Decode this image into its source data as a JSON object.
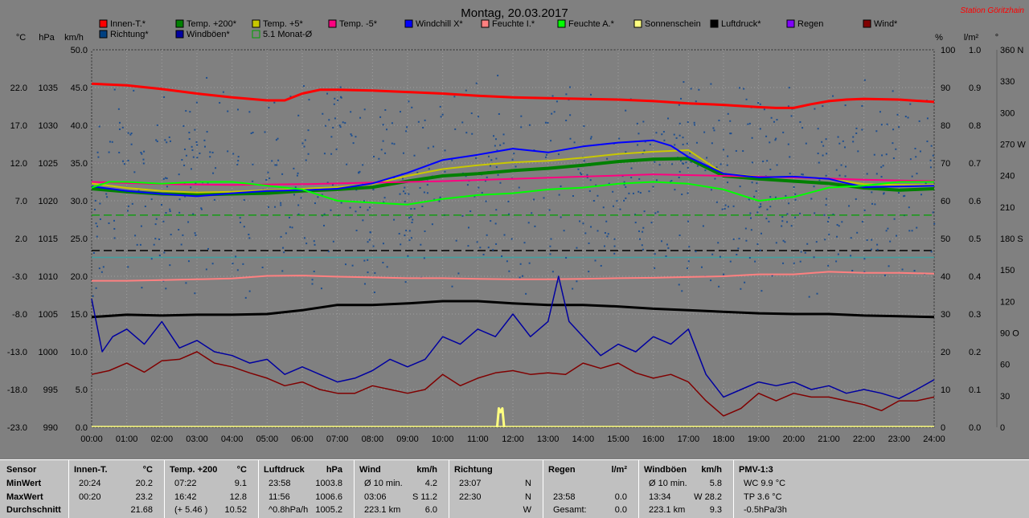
{
  "title": "Montag, 20.03.2017",
  "station": "Station Göritzhain",
  "units": {
    "temp": "°C",
    "press": "hPa",
    "speed": "km/h",
    "percent": "%",
    "rain": "l/m²",
    "deg": "°"
  },
  "legend": [
    {
      "label": "Innen-T.*",
      "color": "#ff0000"
    },
    {
      "label": "Temp. +200*",
      "color": "#008000"
    },
    {
      "label": "Temp. +5*",
      "color": "#c8c800"
    },
    {
      "label": "Temp. -5*",
      "color": "#ff0080"
    },
    {
      "label": "Windchill X*",
      "color": "#0000ff"
    },
    {
      "label": "Feuchte I.*",
      "color": "#ff8080"
    },
    {
      "label": "Feuchte A.*",
      "color": "#00ff00"
    },
    {
      "label": "Sonnenschein",
      "color": "#ffff80"
    },
    {
      "label": "Luftdruck*",
      "color": "#000000"
    },
    {
      "label": "Regen",
      "color": "#8000ff"
    },
    {
      "label": "Wind*",
      "color": "#800000"
    },
    {
      "label": "Richtung*",
      "color": "#004080"
    },
    {
      "label": "Windböen*",
      "color": "#0000a0"
    },
    {
      "label": "5.1 Monat-Ø",
      "color": "#00a000"
    }
  ],
  "chart_data": {
    "type": "line",
    "x_ticks": [
      "00:00",
      "01:00",
      "02:00",
      "03:00",
      "04:00",
      "05:00",
      "06:00",
      "07:00",
      "08:00",
      "09:00",
      "10:00",
      "11:00",
      "12:00",
      "13:00",
      "14:00",
      "15:00",
      "16:00",
      "17:00",
      "18:00",
      "19:00",
      "20:00",
      "21:00",
      "22:00",
      "23:00",
      "24:00"
    ],
    "axes": {
      "temp_ticks": [
        "22.0",
        "17.0",
        "12.0",
        "7.0",
        "2.0",
        "-3.0",
        "-8.0",
        "-13.0",
        "-18.0",
        "-23.0"
      ],
      "press_ticks": [
        "1035",
        "1030",
        "1025",
        "1020",
        "1015",
        "1010",
        "1005",
        "1000",
        "995",
        "990"
      ],
      "speed_ticks": [
        "50.0",
        "45.0",
        "40.0",
        "35.0",
        "30.0",
        "25.0",
        "20.0",
        "15.0",
        "10.0",
        "5.0",
        "0.0"
      ],
      "percent_ticks": [
        "100",
        "90",
        "80",
        "70",
        "60",
        "50",
        "40",
        "30",
        "20",
        "10",
        "0"
      ],
      "rain_ticks": [
        "1.0",
        "0.9",
        "0.8",
        "0.7",
        "0.6",
        "0.5",
        "0.4",
        "0.3",
        "0.2",
        "0.1",
        "0.0"
      ],
      "deg_ticks": [
        "360 N",
        "330",
        "300",
        "270 W",
        "240",
        "210",
        "180 S",
        "150",
        "120",
        "90 O",
        "60",
        "30",
        "0"
      ]
    },
    "temp_range": [
      -23,
      27
    ],
    "series": [
      {
        "name": "Innen-T.*",
        "color": "#ff0000",
        "axis": "temp",
        "x": [
          0,
          1,
          2,
          3,
          4,
          5,
          5.5,
          6,
          6.5,
          7,
          8,
          9,
          10,
          11,
          12,
          13,
          14,
          15,
          16,
          17,
          18,
          19,
          19.5,
          20,
          20.5,
          21,
          21.5,
          22,
          23,
          24
        ],
        "y": [
          22.5,
          22.3,
          21.8,
          21.2,
          20.7,
          20.3,
          20.3,
          21.2,
          21.7,
          21.7,
          21.6,
          21.4,
          21.2,
          20.9,
          20.7,
          20.6,
          20.5,
          20.4,
          20.2,
          19.9,
          19.7,
          19.4,
          19.3,
          19.3,
          19.8,
          20.2,
          20.4,
          20.5,
          20.4,
          20.1
        ]
      },
      {
        "name": "Temp. +200*",
        "color": "#008000",
        "axis": "temp",
        "x": [
          0,
          1,
          2,
          3,
          4,
          5,
          6,
          7,
          8,
          9,
          10,
          11,
          12,
          13,
          14,
          15,
          16,
          17,
          18,
          19,
          20,
          21,
          22,
          23,
          24
        ],
        "y": [
          8.6,
          8.2,
          7.9,
          7.8,
          7.9,
          8.0,
          8.3,
          8.5,
          8.8,
          9.6,
          10.3,
          10.6,
          11.0,
          11.3,
          11.7,
          12.2,
          12.5,
          12.6,
          10.3,
          9.9,
          9.6,
          9.3,
          8.7,
          8.4,
          8.6
        ]
      },
      {
        "name": "Temp. +5*",
        "color": "#c8c800",
        "axis": "temp",
        "x": [
          0,
          1,
          2,
          3,
          4,
          5,
          6,
          7,
          8,
          9,
          10,
          11,
          12,
          13,
          14,
          15,
          16,
          17,
          18,
          19,
          20,
          21,
          22,
          23,
          24
        ],
        "y": [
          9.3,
          8.7,
          8.3,
          8.1,
          8.2,
          8.4,
          8.6,
          8.8,
          9.2,
          10.3,
          11.2,
          11.7,
          12.1,
          12.3,
          12.7,
          13.2,
          13.5,
          13.7,
          10.6,
          10.2,
          10.1,
          9.9,
          9.2,
          9.1,
          9.1
        ]
      },
      {
        "name": "Temp. -5*",
        "color": "#ff0080",
        "axis": "temp",
        "x": [
          0,
          2,
          4,
          6,
          8,
          10,
          12,
          14,
          16,
          18,
          20,
          22,
          24
        ],
        "y": [
          9.5,
          9.2,
          9.1,
          9.2,
          9.4,
          9.6,
          9.9,
          10.2,
          10.5,
          10.3,
          10.1,
          9.8,
          9.6
        ]
      },
      {
        "name": "Windchill X*",
        "color": "#0000ff",
        "axis": "temp",
        "x": [
          0,
          1,
          2,
          3,
          4,
          5,
          6,
          7,
          8,
          9,
          10,
          11,
          12,
          13,
          14,
          15,
          16,
          16.5,
          17,
          18,
          19,
          20,
          21,
          22,
          23,
          24
        ],
        "y": [
          8.9,
          8.3,
          7.9,
          7.6,
          8.0,
          8.3,
          8.4,
          8.6,
          9.3,
          10.7,
          12.4,
          13.1,
          13.9,
          13.4,
          14.2,
          14.7,
          15.0,
          14.3,
          12.8,
          10.6,
          10.1,
          10.2,
          9.9,
          8.8,
          8.9,
          9.0
        ]
      },
      {
        "name": "Feuchte I.*",
        "color": "#ff8080",
        "axis": "percent",
        "x": [
          0,
          1,
          2,
          3,
          4,
          5,
          6,
          7,
          8,
          9,
          10,
          11,
          12,
          13,
          14,
          15,
          16,
          17,
          18,
          19,
          20,
          21,
          22,
          23,
          24
        ],
        "y": [
          38.8,
          38.8,
          39.0,
          39.2,
          39.4,
          40.1,
          40.2,
          39.9,
          39.7,
          39.5,
          39.5,
          39.3,
          39.2,
          39.2,
          39.3,
          39.5,
          39.6,
          39.8,
          40.0,
          40.5,
          40.5,
          41.2,
          40.9,
          40.9,
          40.7
        ]
      },
      {
        "name": "Feuchte A.*",
        "color": "#00ff00",
        "axis": "percent",
        "x": [
          0,
          0.5,
          1,
          2,
          3,
          4,
          5,
          6,
          7,
          8,
          9,
          10,
          11,
          12,
          13,
          14,
          15,
          16,
          17,
          18,
          19,
          20,
          21,
          22,
          23,
          24
        ],
        "y": [
          63.5,
          65,
          65,
          64.5,
          65,
          65,
          64,
          63,
          60,
          59.5,
          59,
          60.5,
          61.5,
          62,
          63,
          63.5,
          64.5,
          65,
          64.5,
          63,
          60,
          61,
          63.5,
          64,
          65,
          65
        ]
      },
      {
        "name": "Luftdruck*",
        "color": "#000000",
        "axis": "press",
        "x": [
          0,
          1,
          2,
          3,
          4,
          5,
          6,
          7,
          8,
          9,
          10,
          11,
          12,
          13,
          14,
          15,
          16,
          17,
          18,
          19,
          20,
          21,
          22,
          23,
          24
        ],
        "y": [
          1004.6,
          1004.9,
          1004.8,
          1004.9,
          1004.9,
          1005.0,
          1005.5,
          1006.2,
          1006.2,
          1006.4,
          1006.7,
          1006.7,
          1006.4,
          1006.2,
          1006.2,
          1006.0,
          1005.7,
          1005.5,
          1005.3,
          1005.1,
          1005.0,
          1005.0,
          1004.8,
          1004.7,
          1004.6
        ]
      },
      {
        "name": "Wind*",
        "color": "#800000",
        "axis": "speed",
        "x": [
          0,
          0.5,
          1,
          1.5,
          2,
          2.5,
          3,
          3.5,
          4,
          4.5,
          5,
          5.5,
          6,
          6.5,
          7,
          7.5,
          8,
          8.5,
          9,
          9.5,
          10,
          10.5,
          11,
          11.5,
          12,
          12.5,
          13,
          13.5,
          14,
          14.5,
          15,
          15.5,
          16,
          16.5,
          17,
          17.5,
          18,
          18.5,
          19,
          19.5,
          20,
          20.5,
          21,
          21.5,
          22,
          22.5,
          23,
          23.5,
          24
        ],
        "y": [
          7,
          7.5,
          8.5,
          7.3,
          8.8,
          9,
          10,
          8.5,
          8,
          7.2,
          6.5,
          5.5,
          6,
          5,
          4.5,
          4.5,
          5.5,
          5,
          4.5,
          5,
          7,
          5.5,
          6.5,
          7.2,
          7.5,
          7,
          7.2,
          7,
          8.5,
          7.8,
          8.5,
          7.2,
          6.5,
          7,
          6,
          3.5,
          1.5,
          2.5,
          4.5,
          3.5,
          4.5,
          4,
          4,
          3.5,
          3,
          2.2,
          3.5,
          3.5,
          4
        ]
      },
      {
        "name": "Windböen*",
        "color": "#0000a0",
        "axis": "speed",
        "x": [
          0,
          0.3,
          0.6,
          1,
          1.5,
          2,
          2.5,
          3,
          3.5,
          4,
          4.5,
          5,
          5.5,
          6,
          6.5,
          7,
          7.5,
          8,
          8.5,
          9,
          9.5,
          10,
          10.5,
          11,
          11.5,
          12,
          12.5,
          13,
          13.3,
          13.6,
          14,
          14.5,
          15,
          15.5,
          16,
          16.5,
          17,
          17.5,
          18,
          18.5,
          19,
          19.5,
          20,
          20.5,
          21,
          21.5,
          22,
          22.5,
          23,
          23.5,
          24
        ],
        "y": [
          17,
          10,
          12,
          13,
          11,
          14,
          10.5,
          11.5,
          10,
          9.5,
          8.5,
          9,
          7,
          8,
          7,
          6,
          6.5,
          7.5,
          9,
          8,
          9,
          12,
          11,
          13,
          12,
          15,
          12,
          14,
          20,
          14,
          12,
          9.5,
          11,
          10,
          12,
          11,
          13,
          7,
          4,
          5,
          6,
          5.5,
          6,
          5,
          5.5,
          4.5,
          5,
          4.5,
          3.8,
          5,
          6.3
        ]
      },
      {
        "name": "Sonnenschein",
        "color": "#ffff80",
        "axis": "rain",
        "x": [
          11.55,
          11.6,
          11.65,
          11.7,
          11.75
        ],
        "y": [
          0,
          0.05,
          0.04,
          0.05,
          0
        ]
      },
      {
        "name": "5.1 Monat-Ø",
        "color": "#00a000",
        "axis": "temp",
        "x": [
          0,
          24
        ],
        "y": [
          5.1,
          5.1
        ]
      }
    ],
    "reference_lines": [
      {
        "axis": "temp",
        "value": 0.4,
        "color": "#000000",
        "style": "dashed"
      },
      {
        "axis": "temp",
        "value": -0.5,
        "color": "#40a0a0",
        "style": "solid"
      }
    ]
  },
  "stats": {
    "row_labels": [
      "Sensor",
      "MinWert",
      "MaxWert",
      "Durchschnitt"
    ],
    "columns": [
      {
        "title": "Innen-T.",
        "unit": "°C",
        "rows": [
          [
            "20:24",
            "20.2"
          ],
          [
            "00:20",
            "23.2"
          ],
          [
            "",
            "21.68"
          ]
        ]
      },
      {
        "title": "Temp. +200",
        "unit": "°C",
        "rows": [
          [
            "07:22",
            "9.1"
          ],
          [
            "16:42",
            "12.8"
          ],
          [
            "(+ 5.46 )",
            "10.52"
          ]
        ]
      },
      {
        "title": "Luftdruck",
        "unit": "hPa",
        "rows": [
          [
            "23:58",
            "1003.8"
          ],
          [
            "11:56",
            "1006.6"
          ],
          [
            "^0.8hPa/h",
            "1005.2"
          ]
        ]
      },
      {
        "title": "Wind",
        "unit": "km/h",
        "rows": [
          [
            "Ø 10 min.",
            "4.2"
          ],
          [
            "03:06",
            "S 11.2"
          ],
          [
            "223.1 km",
            "6.0"
          ]
        ]
      },
      {
        "title": "Richtung",
        "unit": "",
        "rows": [
          [
            "23:07",
            "N"
          ],
          [
            "22:30",
            "N"
          ],
          [
            "",
            "W"
          ]
        ]
      },
      {
        "title": "Regen",
        "unit": "l/m²",
        "rows": [
          [
            "",
            ""
          ],
          [
            "23:58",
            "0.0"
          ],
          [
            "Gesamt:",
            "0.0"
          ]
        ]
      },
      {
        "title": "Windböen",
        "unit": "km/h",
        "rows": [
          [
            "Ø 10 min.",
            "5.8"
          ],
          [
            "13:34",
            "W 28.2"
          ],
          [
            "223.1 km",
            "9.3"
          ]
        ]
      },
      {
        "title": "PMV-1:3",
        "unit": "",
        "rows": [
          [
            "WC 9.9 °C",
            ""
          ],
          [
            "TP 3.6 °C",
            ""
          ],
          [
            "-0.5hPa/3h",
            ""
          ]
        ]
      }
    ]
  }
}
